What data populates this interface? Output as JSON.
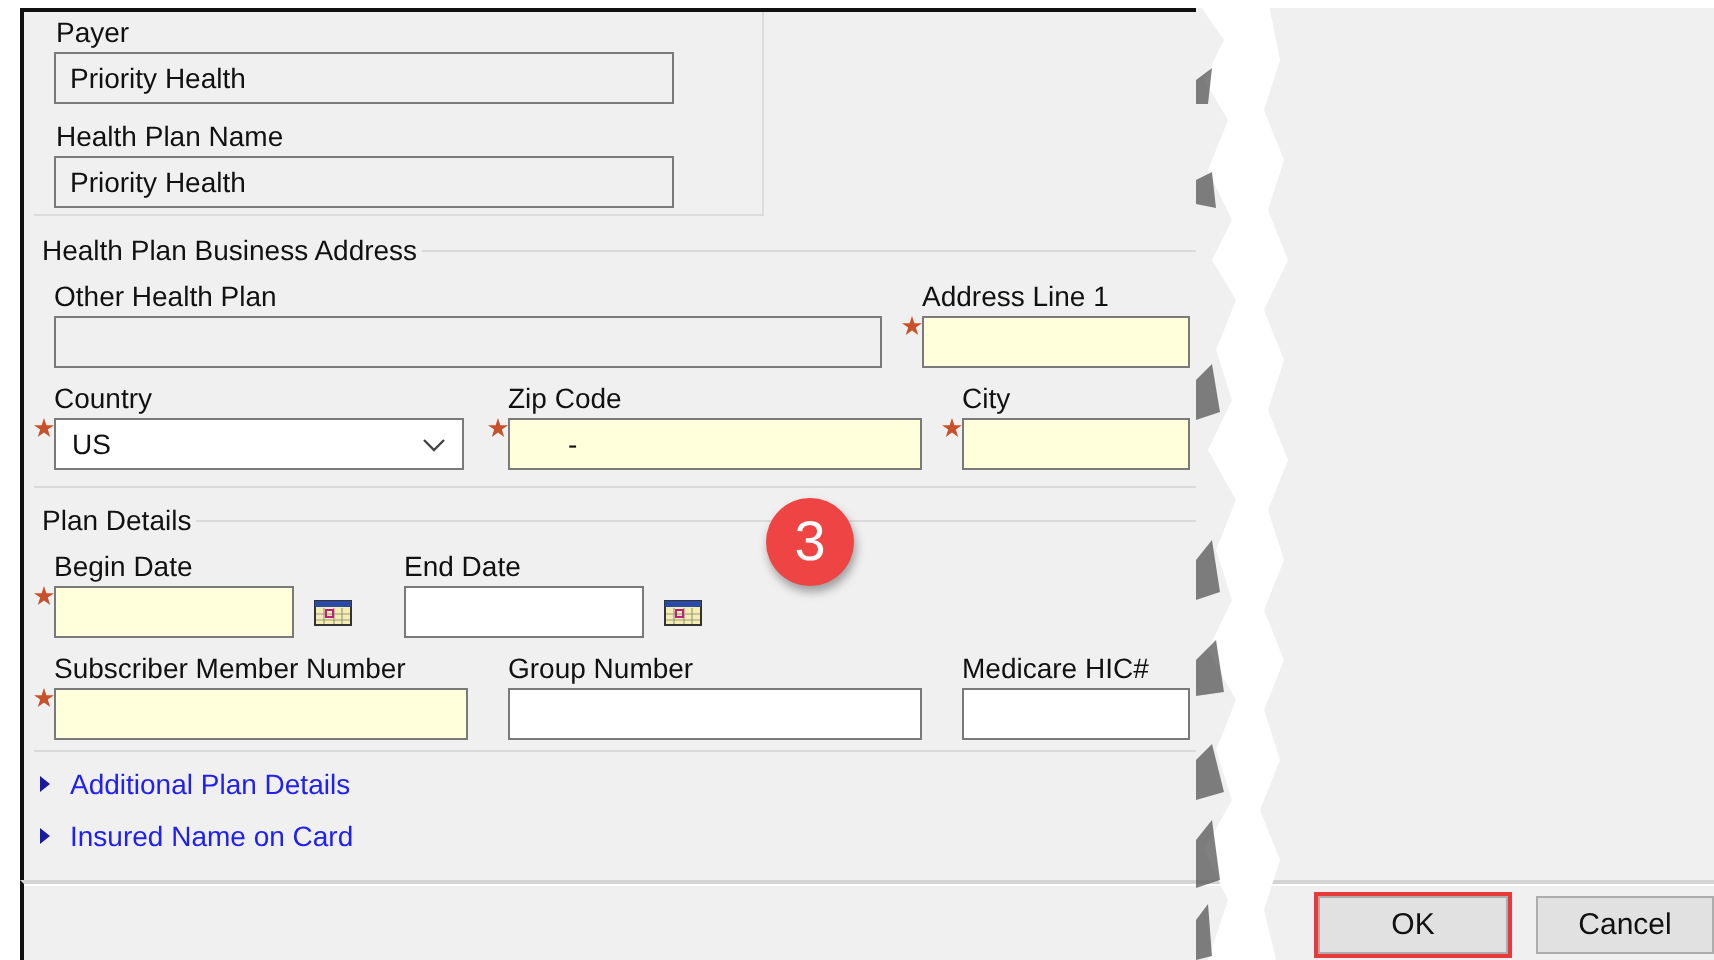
{
  "top_panel": {
    "fields": [
      {
        "label": "Payer",
        "value": "Priority Health",
        "disabled": true
      },
      {
        "label": "Health Plan Name",
        "value": "Priority Health",
        "disabled": true
      }
    ]
  },
  "sections": [
    {
      "title": "Health Plan Business Address",
      "lines": [
        {
          "fields": [
            {
              "label": "Other Health Plan",
              "kind": "text",
              "required": false,
              "disabled": true
            },
            {
              "label": "Address Line 1",
              "kind": "text",
              "required": true,
              "disabled": false
            }
          ]
        },
        {
          "fields": [
            {
              "label": "Country",
              "kind": "combo",
              "value": "US",
              "required": true,
              "disabled": false
            },
            {
              "label": "Zip Code",
              "kind": "text",
              "value": "-",
              "required": true,
              "disabled": false
            },
            {
              "label": "City",
              "kind": "text",
              "required": true,
              "disabled": false
            }
          ]
        }
      ]
    },
    {
      "title": "Plan Details",
      "lines": [
        {
          "fields": [
            {
              "label": "Begin Date",
              "kind": "date",
              "required": true,
              "disabled": false
            },
            {
              "label": "End Date",
              "kind": "date",
              "required": false,
              "disabled": false
            }
          ]
        },
        {
          "fields": [
            {
              "label": "Subscriber Member Number",
              "kind": "text",
              "required": true,
              "disabled": false
            },
            {
              "label": "Group Number",
              "kind": "text",
              "required": false,
              "disabled": false
            },
            {
              "label": "Medicare HIC#",
              "kind": "text",
              "required": false,
              "disabled": false
            }
          ]
        }
      ]
    }
  ],
  "expanders": [
    {
      "label": "Additional Plan Details",
      "expanded": false
    },
    {
      "label": "Insured Name on Card",
      "expanded": false
    }
  ],
  "callout": "3",
  "buttons": [
    {
      "label": "OK",
      "highlighted": true
    },
    {
      "label": "Cancel",
      "highlighted": false
    }
  ]
}
